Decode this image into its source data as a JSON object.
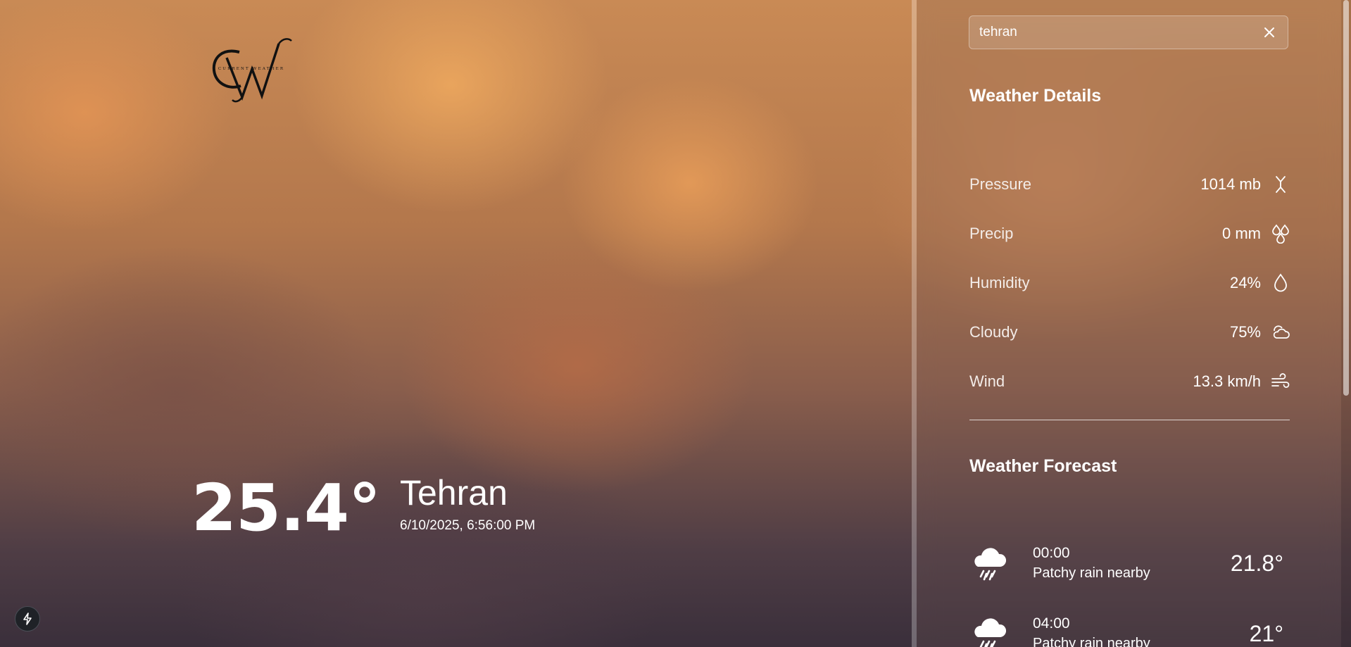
{
  "brand": {
    "logo_icon": "cw-monogram-logo",
    "logo_text": "CURRENT WEATHER"
  },
  "current": {
    "temperature": "25.4°",
    "city": "Tehran",
    "datetime": "6/10/2025, 6:56:00 PM"
  },
  "search": {
    "value": "tehran",
    "clear_icon": "close-icon"
  },
  "details": {
    "title": "Weather Details",
    "rows": [
      {
        "label": "Pressure",
        "value": "1014 mb",
        "icon": "pressure-arrows-icon"
      },
      {
        "label": "Precip",
        "value": "0 mm",
        "icon": "droplets-icon"
      },
      {
        "label": "Humidity",
        "value": "24%",
        "icon": "droplet-icon"
      },
      {
        "label": "Cloudy",
        "value": "75%",
        "icon": "cloud-sun-icon"
      },
      {
        "label": "Wind",
        "value": "13.3 km/h",
        "icon": "wind-icon"
      }
    ]
  },
  "forecast": {
    "title": "Weather Forecast",
    "items": [
      {
        "time": "00:00",
        "condition": "Patchy rain nearby",
        "temp": "21.8°",
        "icon": "cloud-rain-icon"
      },
      {
        "time": "04:00",
        "condition": "Patchy rain nearby",
        "temp": "21°",
        "icon": "cloud-rain-icon"
      }
    ]
  },
  "misc": {
    "bolt_icon": "bolt-icon"
  },
  "colors": {
    "text": "#ffffff",
    "sidebar_tint": "#785a55"
  }
}
